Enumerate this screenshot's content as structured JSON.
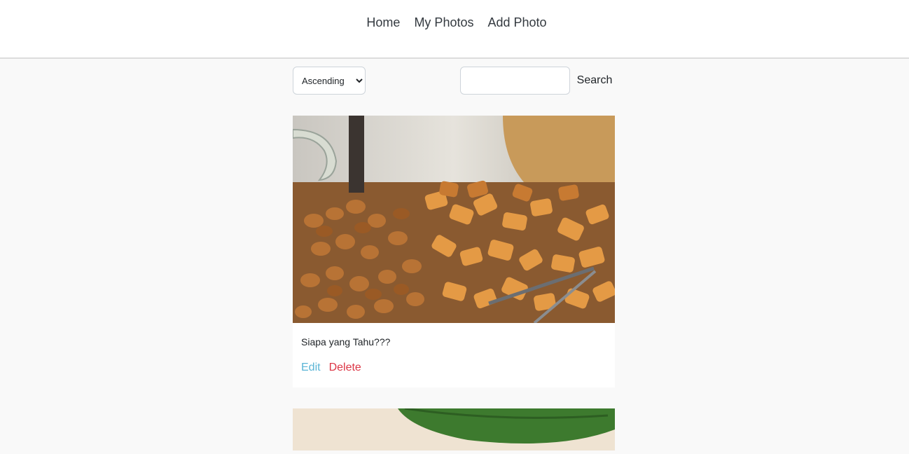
{
  "nav": {
    "items": [
      {
        "label": "Home"
      },
      {
        "label": "My Photos"
      },
      {
        "label": "Add Photo"
      }
    ]
  },
  "controls": {
    "sort_selected": "Ascending",
    "search_value": "",
    "search_button_label": "Search"
  },
  "photos": [
    {
      "caption": "Siapa yang Tahu???",
      "edit_label": "Edit",
      "delete_label": "Delete"
    }
  ],
  "colors": {
    "edit": "#5bb5d6",
    "delete": "#dc3545",
    "background": "#f9f9f9"
  }
}
